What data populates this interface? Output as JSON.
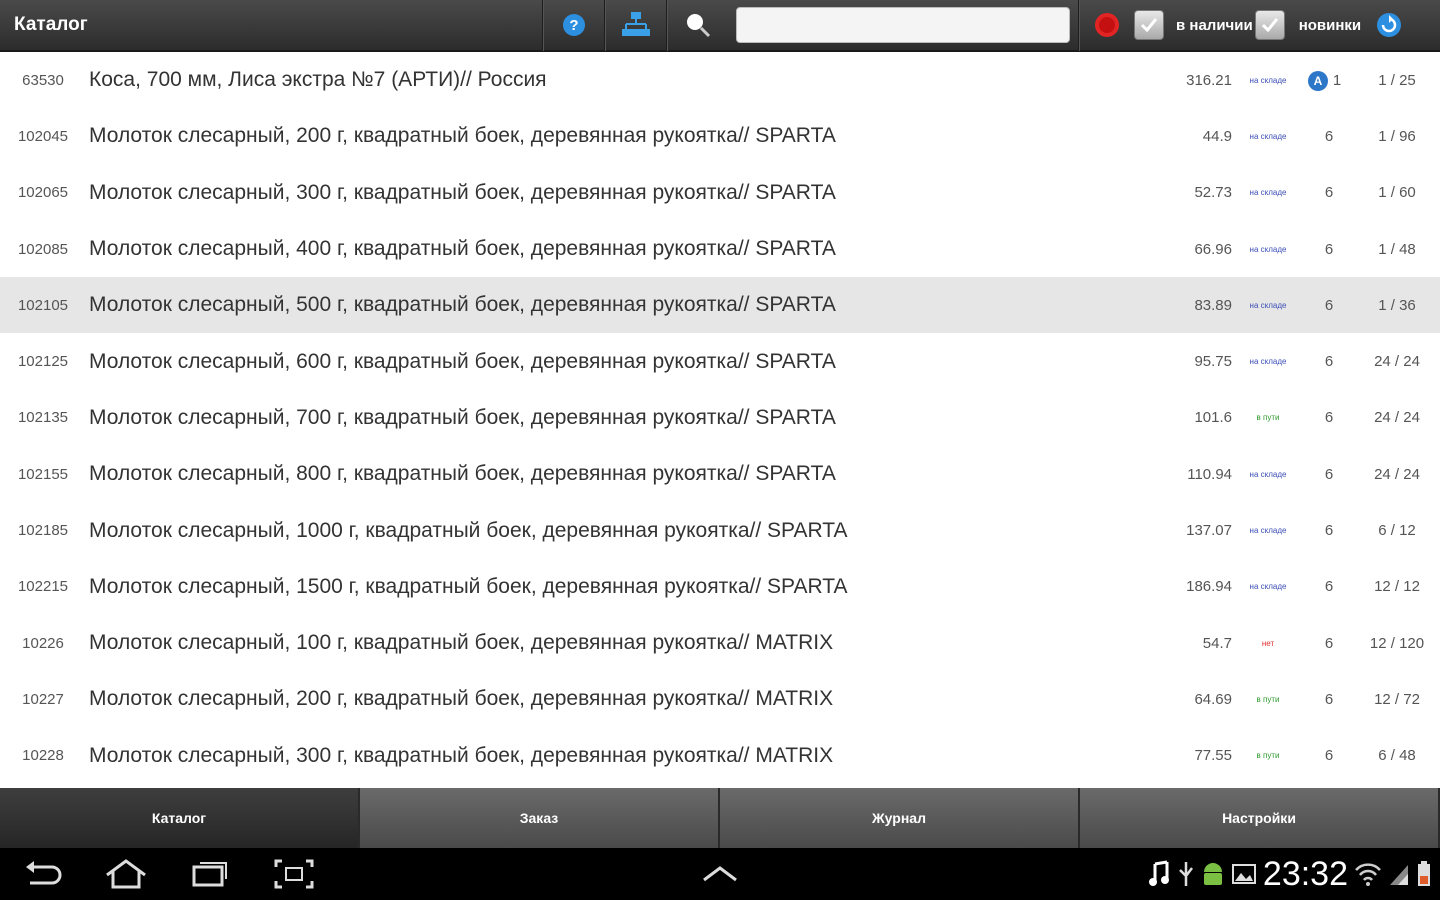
{
  "header": {
    "title": "Каталог",
    "search_value": "",
    "in_stock_label": "в наличии",
    "new_label": "новинки"
  },
  "rows": [
    {
      "code": "63530",
      "name": "Коса, 700 мм,  Лиса экстра №7 (АРТИ)// Россия",
      "price": "316.21",
      "stock": "на складе",
      "stock_color": "#3d4fb5",
      "qty": "1",
      "pack": "1 / 25",
      "badge": "A"
    },
    {
      "code": "102045",
      "name": "Молоток слесарный, 200 г, квадратный боек, деревянная рукоятка// SPARTA",
      "price": "44.9",
      "stock": "на складе",
      "stock_color": "#3d4fb5",
      "qty": "6",
      "pack": "1 / 96"
    },
    {
      "code": "102065",
      "name": "Молоток слесарный, 300 г, квадратный боек, деревянная рукоятка// SPARTA",
      "price": "52.73",
      "stock": "на складе",
      "stock_color": "#3d4fb5",
      "qty": "6",
      "pack": "1 / 60"
    },
    {
      "code": "102085",
      "name": "Молоток слесарный, 400 г, квадратный боек, деревянная рукоятка// SPARTA",
      "price": "66.96",
      "stock": "на складе",
      "stock_color": "#3d4fb5",
      "qty": "6",
      "pack": "1 / 48"
    },
    {
      "code": "102105",
      "name": "Молоток слесарный, 500 г, квадратный боек, деревянная рукоятка// SPARTA",
      "price": "83.89",
      "stock": "на складе",
      "stock_color": "#3d4fb5",
      "qty": "6",
      "pack": "1 / 36",
      "selected": true
    },
    {
      "code": "102125",
      "name": "Молоток слесарный, 600 г, квадратный боек, деревянная рукоятка// SPARTA",
      "price": "95.75",
      "stock": "на складе",
      "stock_color": "#3d4fb5",
      "qty": "6",
      "pack": "24 / 24"
    },
    {
      "code": "102135",
      "name": "Молоток слесарный, 700 г, квадратный боек, деревянная рукоятка// SPARTA",
      "price": "101.6",
      "stock": "в пути",
      "stock_color": "#2e9a2e",
      "qty": "6",
      "pack": "24 / 24"
    },
    {
      "code": "102155",
      "name": "Молоток слесарный, 800 г, квадратный боек, деревянная рукоятка// SPARTA",
      "price": "110.94",
      "stock": "на складе",
      "stock_color": "#3d4fb5",
      "qty": "6",
      "pack": "24 / 24"
    },
    {
      "code": "102185",
      "name": "Молоток слесарный, 1000 г, квадратный боек, деревянная рукоятка// SPARTA",
      "price": "137.07",
      "stock": "на складе",
      "stock_color": "#3d4fb5",
      "qty": "6",
      "pack": "6 / 12"
    },
    {
      "code": "102215",
      "name": "Молоток слесарный, 1500 г, квадратный боек, деревянная рукоятка// SPARTA",
      "price": "186.94",
      "stock": "на складе",
      "stock_color": "#3d4fb5",
      "qty": "6",
      "pack": "12 / 12"
    },
    {
      "code": "10226",
      "name": "Молоток слесарный, 100 г, квадратный боек, деревянная рукоятка// MATRIX",
      "price": "54.7",
      "stock": "нет",
      "stock_color": "#e03030",
      "qty": "6",
      "pack": "12 / 120"
    },
    {
      "code": "10227",
      "name": "Молоток слесарный, 200 г, квадратный боек, деревянная рукоятка// MATRIX",
      "price": "64.69",
      "stock": "в пути",
      "stock_color": "#2e9a2e",
      "qty": "6",
      "pack": "12 / 72"
    },
    {
      "code": "10228",
      "name": "Молоток слесарный, 300 г, квадратный боек, деревянная рукоятка// MATRIX",
      "price": "77.55",
      "stock": "в пути",
      "stock_color": "#2e9a2e",
      "qty": "6",
      "pack": "6 / 48"
    }
  ],
  "tabs": [
    {
      "label": "Каталог",
      "active": true
    },
    {
      "label": "Заказ"
    },
    {
      "label": "Журнал"
    },
    {
      "label": "Настройки"
    }
  ],
  "system": {
    "clock": "23:32"
  },
  "icons": {
    "help": "help-icon",
    "tree": "category-tree-icon",
    "search": "search-icon",
    "clear": "clear-icon",
    "refresh": "refresh-icon"
  },
  "colors": {
    "accent": "#2d77c8",
    "selected_row": "#e6e6e6"
  }
}
